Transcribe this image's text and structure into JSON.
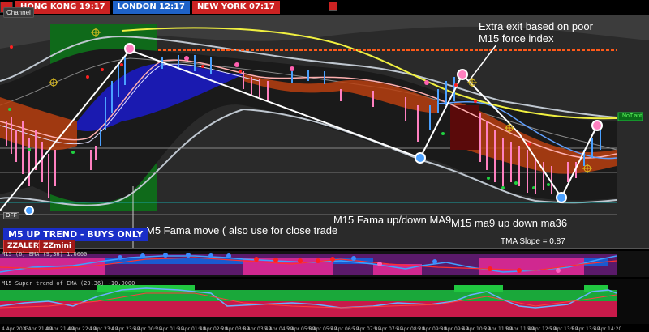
{
  "sessions": [
    {
      "label": "HONG KONG 19:17",
      "color": "#cc2222"
    },
    {
      "label": "LONDON 12:17",
      "color": "#1e62c8"
    },
    {
      "label": "NEW YORK 07:17",
      "color": "#cc2222"
    }
  ],
  "channel_label": "Channel",
  "annotations": {
    "extra_exit": "Extra exit based on poor",
    "extra_exit_line2": "M15 force index",
    "m5_fama": "M5 Fama move ( also use for close trade",
    "m15_fama": "M15 Fama up/down MA9",
    "m15_ma9": "M15 ma9 up down ma36",
    "tma_slope": "TMA Slope = 0.87"
  },
  "trend_banner": "M5 UP TREND - BUYS ONLY",
  "buttons": {
    "zzalert": "ZZALERT",
    "zzmini": "ZZmini"
  },
  "indicators": {
    "ind1": "M15 (6) EMA (9,36) 1.0000",
    "ind2": "M15 Super trend of EMA (20,36) -10.0000"
  },
  "price_tags": {
    "green": "NoT.ant",
    "left": "OFF"
  },
  "time_ticks": [
    "4 Apr 2023",
    "4 Apr 21:00",
    "4 Apr 21:40",
    "4 Apr 22:20",
    "4 Apr 23:00",
    "4 Apr 23:40",
    "5 Apr 00:20",
    "5 Apr 01:00",
    "5 Apr 01:40",
    "5 Apr 02:20",
    "5 Apr 03:00",
    "5 Apr 03:40",
    "5 Apr 04:20",
    "5 Apr 05:00",
    "5 Apr 05:40",
    "5 Apr 06:20",
    "5 Apr 07:00",
    "5 Apr 07:40",
    "5 Apr 08:20",
    "5 Apr 09:00",
    "5 Apr 09:40",
    "5 Apr 10:20",
    "5 Apr 11:00",
    "5 Apr 11:40",
    "5 Apr 12:20",
    "5 Apr 13:00",
    "5 Apr 13:40",
    "5 Apr 14:20"
  ],
  "colors": {
    "uptrend_zone": "#0f6a1a",
    "band": "#bfc7d0",
    "ma_long": "#f0f040",
    "buy_fill": "#1a1ab0",
    "sell_fill": "#b84010",
    "level_orange": "#ff5a1a"
  }
}
